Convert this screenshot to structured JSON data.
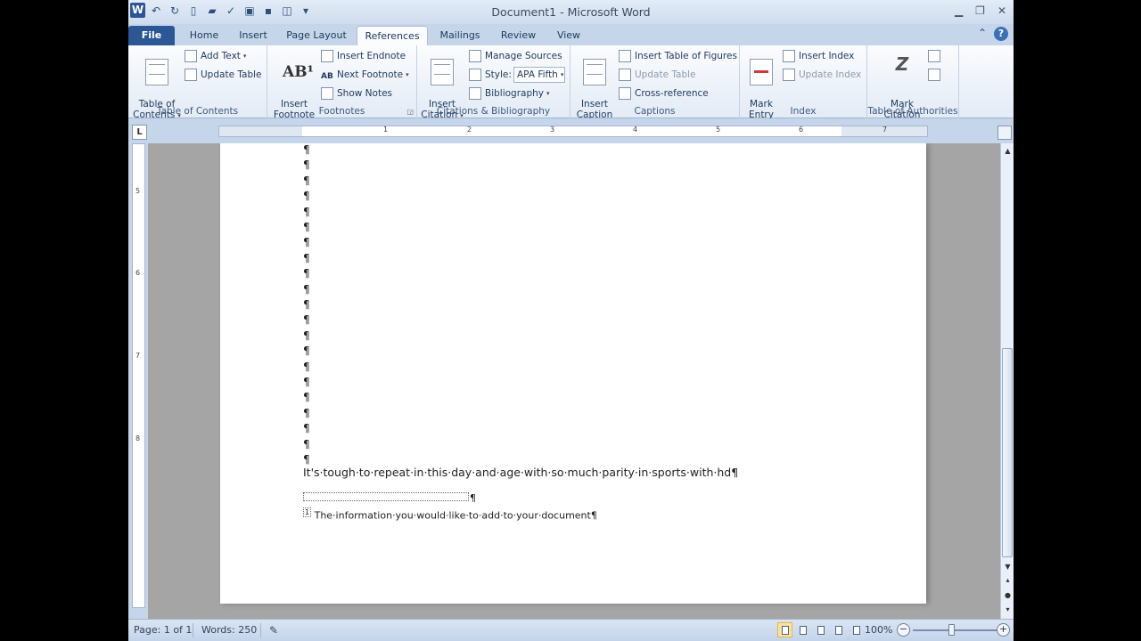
{
  "title": "Document1  -  Microsoft Word",
  "app_logo": "W",
  "tabs": [
    "File",
    "Home",
    "Insert",
    "Page Layout",
    "References",
    "Mailings",
    "Review",
    "View"
  ],
  "active_tab": "References",
  "ribbon": {
    "toc": {
      "big": "Table of\nContents",
      "add_text": "Add Text",
      "update_table": "Update Table",
      "group": "Table of Contents"
    },
    "footnotes": {
      "big": "Insert\nFootnote",
      "insert_endnote": "Insert Endnote",
      "next_footnote": "Next Footnote",
      "show_notes": "Show Notes",
      "group": "Footnotes"
    },
    "citations": {
      "big": "Insert\nCitation",
      "manage_sources": "Manage Sources",
      "style_label": "Style:",
      "style_value": "APA Fifth",
      "bibliography": "Bibliography",
      "group": "Citations & Bibliography"
    },
    "captions": {
      "big": "Insert\nCaption",
      "insert_table_figures": "Insert Table of Figures",
      "update_table": "Update Table",
      "cross_reference": "Cross-reference",
      "group": "Captions"
    },
    "index": {
      "big": "Mark\nEntry",
      "insert_index": "Insert Index",
      "update_index": "Update Index",
      "group": "Index"
    },
    "authorities": {
      "big": "Mark\nCitation",
      "group": "Table of Authorities"
    }
  },
  "ruler_numbers": [
    "1",
    "2",
    "3",
    "4",
    "5",
    "6",
    "7"
  ],
  "vruler_numbers": [
    "5",
    "6",
    "7",
    "8"
  ],
  "document": {
    "empty_paragraphs": [
      "¶",
      "¶",
      "¶",
      "¶",
      "¶",
      "¶",
      "¶",
      "¶",
      "¶",
      "¶",
      "¶",
      "¶",
      "¶",
      "¶",
      "¶",
      "¶",
      "¶",
      "¶",
      "¶",
      "¶",
      "¶"
    ],
    "body_line": "It's·tough·to·repeat·in·this·day·and·age·with·so·much·parity·in·sports·with·hd¶",
    "footnote_sep_mark": "¶",
    "footnote_text": "The·information·you·would·like·to·add·to·your·document¶",
    "footnote_ref": "1"
  },
  "status": {
    "page": "Page: 1 of 1",
    "words": "Words: 250",
    "zoom": "100%"
  }
}
